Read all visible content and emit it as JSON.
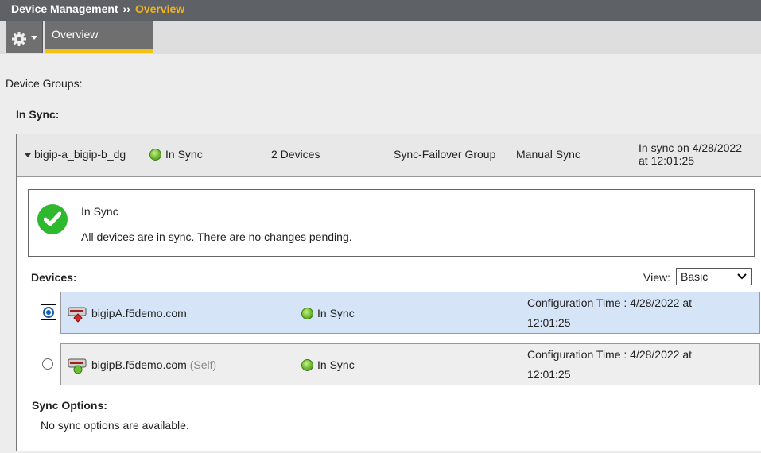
{
  "header": {
    "section": "Device Management",
    "separator": "››",
    "current": "Overview"
  },
  "tabs": [
    {
      "label": "Overview",
      "active": true
    }
  ],
  "icons": {
    "menu": "gear-icon",
    "status_ok": "green-dot-icon",
    "check": "checkmark-icon"
  },
  "page": {
    "device_groups_label": "Device Groups:",
    "in_sync_heading": "In Sync:"
  },
  "group": {
    "name": "bigip-a_bigip-b_dg",
    "status": "In Sync",
    "devices": "2 Devices",
    "type": "Sync-Failover Group",
    "sync_type": "Manual Sync",
    "last_sync_line1": "In sync on 4/28/2022",
    "last_sync_line2": "at 12:01:25"
  },
  "status_box": {
    "title": "In Sync",
    "message": "All devices are in sync. There are no changes pending."
  },
  "devices_section": {
    "label": "Devices:",
    "view_label": "View:",
    "view_value": "Basic"
  },
  "devices": [
    {
      "name": "bigipA.f5demo.com",
      "self_tag": "",
      "status": "In Sync",
      "config_time_line1": "Configuration Time : 4/28/2022 at",
      "config_time_line2": "12:01:25",
      "selected": true
    },
    {
      "name": "bigipB.f5demo.com",
      "self_tag": "(Self)",
      "status": "In Sync",
      "config_time_line1": "Configuration Time : 4/28/2022 at",
      "config_time_line2": "12:01:25",
      "selected": false
    }
  ],
  "sync_options": {
    "label": "Sync Options:",
    "message": "No sync options are available."
  },
  "colors": {
    "accent": "#f3b31d",
    "tab_underline": "#f3c10f",
    "selected_row": "#d5e5f7",
    "ok_green": "#2eb82e"
  }
}
